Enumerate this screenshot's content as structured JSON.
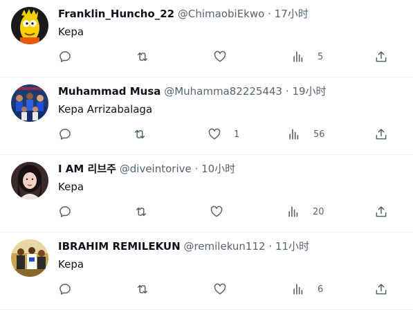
{
  "tweets": [
    {
      "name": "Franklin_Huncho_22",
      "handle": "@ChimaobiEkwo",
      "separator": "·",
      "time": "17小时",
      "text": "Kepa",
      "likes": "",
      "views": "5",
      "avatar_icon": "simpson-character-avatar",
      "avatar_bg": "#1a1a1a"
    },
    {
      "name": "Muhammad Musa",
      "handle": "@Muhamma82225443",
      "separator": "·",
      "time": "19小时",
      "text": "Kepa Arrizabalaga",
      "likes": "1",
      "views": "56",
      "avatar_icon": "team-photo-avatar",
      "avatar_bg": "#1e3a6e"
    },
    {
      "name": "I AM 리브주",
      "handle": "@diveintorive",
      "separator": "·",
      "time": "10小时",
      "text": "Kepa",
      "likes": "",
      "views": "20",
      "avatar_icon": "portrait-avatar",
      "avatar_bg": "#3a2a2a"
    },
    {
      "name": "IBRAHIM REMILEKUN",
      "handle": "@remilekun112",
      "separator": "·",
      "time": "11小时",
      "text": "Kepa",
      "likes": "",
      "views": "6",
      "avatar_icon": "group-photo-avatar",
      "avatar_bg": "#c9a64a"
    }
  ],
  "icons": {
    "reply": "reply-icon",
    "retweet": "retweet-icon",
    "like": "like-icon",
    "views": "views-icon",
    "share": "share-icon"
  },
  "colors": {
    "text_primary": "#0f1419",
    "text_secondary": "#536471",
    "divider": "#eff3f4"
  }
}
